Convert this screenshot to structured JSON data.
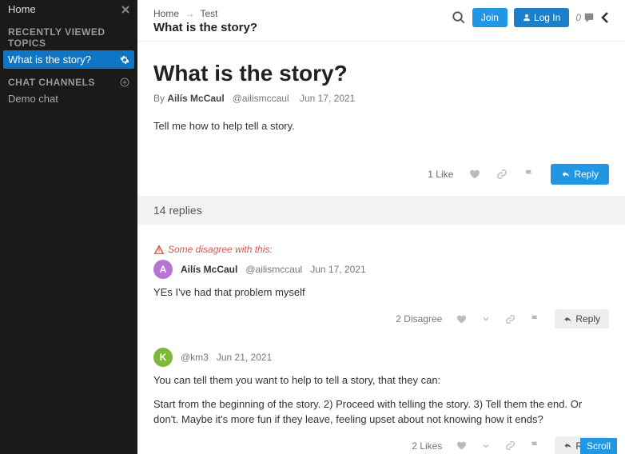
{
  "sidebar": {
    "home": "Home",
    "recent": {
      "heading": "RECENTLY VIEWED TOPICS",
      "items": [
        "What is the story?"
      ]
    },
    "chat": {
      "heading": "CHAT CHANNELS",
      "items": [
        "Demo chat"
      ]
    }
  },
  "header": {
    "crumbs": [
      "Home",
      "Test"
    ],
    "title": "What is the story?",
    "join": "Join",
    "login": "Log In",
    "comment_count": "0"
  },
  "post": {
    "title": "What is the story?",
    "by": "By",
    "author": "Ailís McCaul",
    "handle": "@ailismccaul",
    "date": "Jun 17, 2021",
    "body": "Tell me how to help tell a story.",
    "likes": "1 Like",
    "reply_btn": "Reply"
  },
  "replies_bar": "14 replies",
  "replies": [
    {
      "flag": "Some disagree with this:",
      "avatar": "A",
      "avclass": "av-a",
      "author": "Ailís McCaul",
      "handle": "@ailismccaul",
      "date": "Jun 17, 2021",
      "body": "YEs I've had that problem myself",
      "metric": "2 Disagree"
    },
    {
      "avatar": "K",
      "avclass": "av-k",
      "author": "",
      "handle": "@km3",
      "date": "Jun 21, 2021",
      "body": "You can tell them you want to help to tell a story, that they can:",
      "body2": "Start from the beginning of the story. 2) Proceed with telling the story. 3) Tell them the end. Or don't. Maybe it's more fun if they leave, feeling upset about not knowing how it ends?",
      "metric": "2 Likes"
    }
  ],
  "reply_btn_small": "Reply",
  "scroll": "Scroll"
}
